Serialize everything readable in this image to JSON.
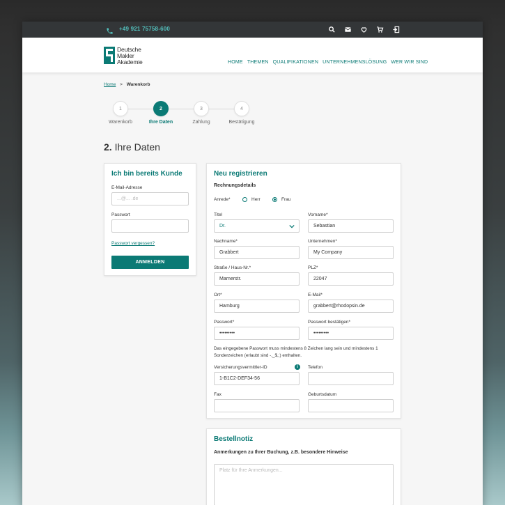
{
  "topbar": {
    "phone": "+49 921 75758-600",
    "icons": [
      "search-icon",
      "mail-icon",
      "heart-icon",
      "cart-icon",
      "login-icon"
    ]
  },
  "header": {
    "logo_lines": [
      "Deutsche",
      "Makler",
      "Akademie"
    ],
    "nav": [
      "HOME",
      "THEMEN",
      "QUALIFIKATIONEN",
      "UNTERNEHMENSLÖSUNG",
      "WER WIR SIND"
    ]
  },
  "breadcrumb": {
    "home": "Home",
    "sep": ">",
    "current": "Warenkorb"
  },
  "steps": [
    {
      "num": "1",
      "label": "Warenkorb"
    },
    {
      "num": "2",
      "label": "Ihre Daten"
    },
    {
      "num": "3",
      "label": "Zahlung"
    },
    {
      "num": "4",
      "label": "Bestätigung"
    }
  ],
  "active_step": 2,
  "page_title": {
    "num": "2.",
    "text": "Ihre Daten"
  },
  "login": {
    "title": "Ich bin bereits Kunde",
    "email_label": "E-Mail-Adresse",
    "email_placeholder": "...@... .de",
    "password_label": "Passwort",
    "password_value": "",
    "forgot": "Passwort vergessen?",
    "submit": "ANMELDEN"
  },
  "register": {
    "title": "Neu registrieren",
    "section": "Rechnungsdetails",
    "salutation_label": "Anrede*",
    "salutation_options": [
      "Herr",
      "Frau"
    ],
    "salutation_selected": "Frau",
    "titel_label": "Titel",
    "titel_value": "Dr.",
    "vorname_label": "Vorname*",
    "vorname_value": "Sebastian",
    "nachname_label": "Nachname*",
    "nachname_value": "Grabbert",
    "unternehmen_label": "Unternehmen*",
    "unternehmen_value": "My Company",
    "strasse_label": "Straße / Haus-Nr.*",
    "strasse_value": "Marnerstr.",
    "plz_label": "PLZ*",
    "plz_value": "22047",
    "ort_label": "Ort*",
    "ort_value": "Hamburg",
    "email_label": "E-Mail*",
    "email_value": "grabbert@rhodopsin.de",
    "passwort_label": "Passwort*",
    "passwort_value": "•••••••••",
    "passwort2_label": "Passwort bestätigen*",
    "passwort2_value": "•••••••••",
    "hint": "Das eingegebene Passwort  muss mindestens 8 Zeichen lang sein und mindestens 1 Sonderzeichen (erlaubt sind -,_$,;) enthalten.",
    "vermittler_label": "Versicherungsvermittler-ID",
    "vermittler_value": "1-B1C2-DEF34-56",
    "telefon_label": "Telefon",
    "telefon_value": "",
    "fax_label": "Fax",
    "fax_value": "",
    "geburtsdatum_label": "Geburtsdatum",
    "geburtsdatum_value": ""
  },
  "note": {
    "title": "Bestellnotiz",
    "label": "Anmerkungen zu Ihrer Buchung, z.B. besondere Hinweise",
    "placeholder": "Platz für Ihre Anmerkungen..."
  },
  "colors": {
    "accent": "#0b7a75",
    "topbar": "#333638",
    "topbar_text": "#53c0bd"
  }
}
